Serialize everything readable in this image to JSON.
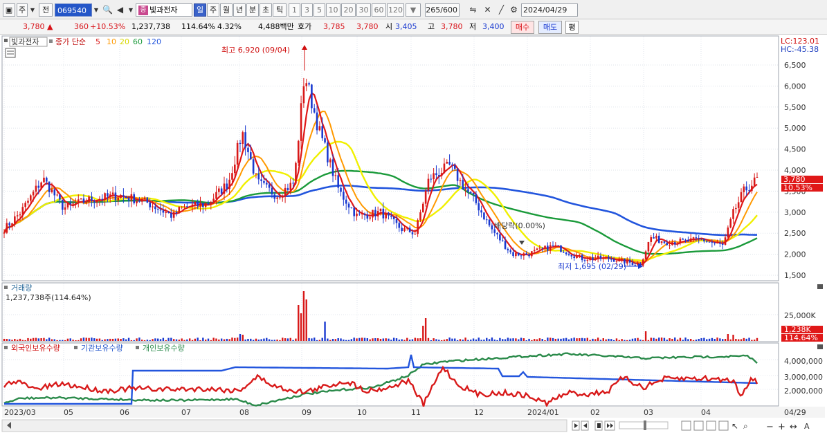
{
  "toolbar": {
    "type_label": "주",
    "prev_label": "전",
    "stock_code": "069540",
    "stock_name": "빛과전자",
    "badge": "중",
    "periods": [
      "일",
      "주",
      "월",
      "년",
      "분",
      "초",
      "틱"
    ],
    "selected_period": "일",
    "intervals": [
      "1",
      "3",
      "5",
      "10",
      "20",
      "30",
      "60",
      "120"
    ],
    "count_display": "265",
    "count_max": "/600",
    "date": "2024/04/29"
  },
  "quote": {
    "price": "3,780",
    "change": "360",
    "change_pct": "+10.53%",
    "volume": "1,237,738",
    "volume_ratio": "114.64%",
    "turnover_pct": "4.32%",
    "amount": "4,488백만",
    "hoga_label": "호가",
    "ask": "3,785",
    "bid": "3,780",
    "open_label": "시",
    "open": "3,405",
    "high_label": "고",
    "high": "3,780",
    "low_label": "저",
    "low": "3,400",
    "buy_label": "매수",
    "sell_label": "매도",
    "avg_label": "평"
  },
  "price_panel": {
    "stock_label": "빛과전자",
    "ma_title": "종가 단순",
    "ma_periods": [
      "5",
      "10",
      "20",
      "60",
      "120"
    ],
    "ma_colors": [
      "#e01818",
      "#ff9900",
      "#e6e600",
      "#1a9a3a",
      "#2255dd"
    ],
    "lc_text": "LC:123.01",
    "hc_text": "HC:-45.38",
    "high_annotation": "최고 6,920 (09/04)",
    "low_annotation": "최저 1,695 (02/29)",
    "dividend_annotation": "배당락(0.00%)",
    "last_price_label": "3,780",
    "last_pct_label": "10.53%",
    "y_ticks": [
      "6,500",
      "6,000",
      "5,500",
      "5,000",
      "4,500",
      "4,000",
      "3,500",
      "3,000",
      "2,500",
      "2,000",
      "1,500"
    ]
  },
  "volume_panel": {
    "title": "거래량",
    "value_text": "1,237,738주(114.64%)",
    "y_ticks": [
      "25,000K"
    ],
    "last_label": "1,238K",
    "last_pct": "114.64%"
  },
  "holding_panel": {
    "foreign_label": "외국인보유수량",
    "inst_label": "기관보유수량",
    "indiv_label": "개인보유수량",
    "colors": {
      "foreign": "#d81a1a",
      "inst": "#2255dd",
      "indiv": "#2a8a4a"
    },
    "y_ticks": [
      "4,000,000",
      "3,000,000",
      "2,000,000"
    ]
  },
  "x_axis": {
    "labels": [
      "2023/03",
      "05",
      "06",
      "07",
      "08",
      "09",
      "10",
      "11",
      "12",
      "2024/01",
      "02",
      "03",
      "04"
    ],
    "right_label": "04/29"
  },
  "chart_data": {
    "type": "candlestick",
    "title": "빛과전자",
    "ylim": [
      1400,
      7000
    ],
    "monthly_closes": [
      {
        "month": "2023/03",
        "close": 2900
      },
      {
        "month": "2023/04",
        "close": 3400
      },
      {
        "month": "2023/05",
        "close": 3200
      },
      {
        "month": "2023/06",
        "close": 3200
      },
      {
        "month": "2023/07",
        "close": 3100
      },
      {
        "month": "2023/08",
        "close": 3500
      },
      {
        "month": "2023/09",
        "close": 4600
      },
      {
        "month": "2023/10",
        "close": 2900
      },
      {
        "month": "2023/11",
        "close": 3200
      },
      {
        "month": "2023/12",
        "close": 2400
      },
      {
        "month": "2024/01",
        "close": 2000
      },
      {
        "month": "2024/02",
        "close": 1900
      },
      {
        "month": "2024/03",
        "close": 2300
      },
      {
        "month": "2024/04",
        "close": 3780
      }
    ],
    "high": {
      "value": 6920,
      "date": "09/04"
    },
    "low": {
      "value": 1695,
      "date": "02/29"
    }
  }
}
